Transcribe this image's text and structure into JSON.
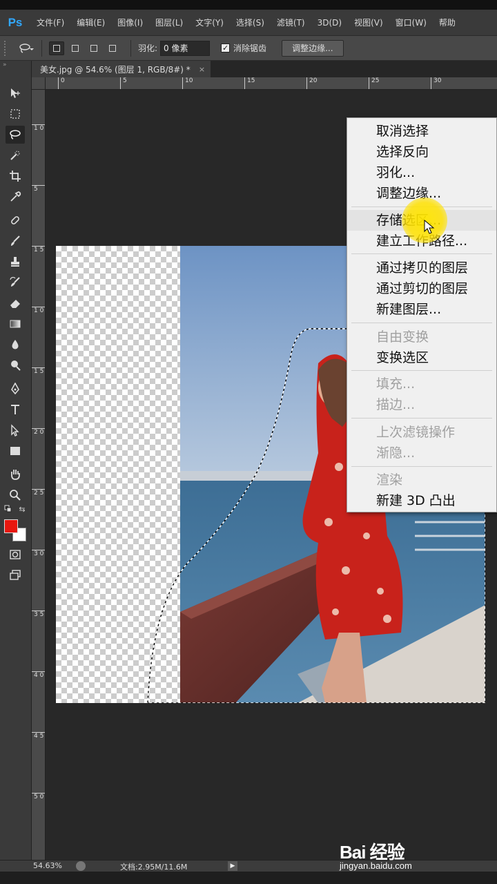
{
  "app": {
    "logo": "Ps"
  },
  "menubar": {
    "items": [
      "文件(F)",
      "编辑(E)",
      "图像(I)",
      "图层(L)",
      "文字(Y)",
      "选择(S)",
      "滤镜(T)",
      "3D(D)",
      "视图(V)",
      "窗口(W)",
      "帮助"
    ]
  },
  "options": {
    "feather_label": "羽化:",
    "feather_value": "0 像素",
    "antialias_label": "消除锯齿",
    "antialias_checked": "✓",
    "refine_edge_label": "调整边缘..."
  },
  "document": {
    "tab_title": "美女.jpg @ 54.6% (图层 1, RGB/8#) *",
    "close": "×"
  },
  "ruler": {
    "h_labels": [
      "0",
      "5",
      "10",
      "15",
      "20",
      "25",
      "30"
    ],
    "v_labels": [
      "1 0",
      "5",
      "1 5",
      "1 0",
      "1 5",
      "2 0",
      "2 5",
      "3 0",
      "3 5",
      "4 0",
      "4 5",
      "5 0"
    ]
  },
  "context_menu": {
    "items": [
      {
        "label": "取消选择",
        "enabled": true
      },
      {
        "label": "选择反向",
        "enabled": true
      },
      {
        "label": "羽化...",
        "enabled": true
      },
      {
        "label": "调整边缘...",
        "enabled": true
      },
      {
        "label": "存储选区...",
        "enabled": true
      },
      {
        "label": "建立工作路径...",
        "enabled": true
      },
      {
        "label": "通过拷贝的图层",
        "enabled": true
      },
      {
        "label": "通过剪切的图层",
        "enabled": true
      },
      {
        "label": "新建图层...",
        "enabled": true
      },
      {
        "label": "自由变换",
        "enabled": false
      },
      {
        "label": "变换选区",
        "enabled": true
      },
      {
        "label": "填充...",
        "enabled": false
      },
      {
        "label": "描边...",
        "enabled": false
      },
      {
        "label": "上次滤镜操作",
        "enabled": false
      },
      {
        "label": "渐隐...",
        "enabled": false
      },
      {
        "label": "渲染",
        "enabled": false
      },
      {
        "label": "新建 3D 凸出",
        "enabled": true
      }
    ]
  },
  "status": {
    "zoom": "54.63%",
    "doc_info": "文档:2.95M/11.6M"
  },
  "colors": {
    "foreground": "#e8170f",
    "background": "#ffffff"
  },
  "watermark": {
    "logo": "Bai 经验",
    "url": "jingyan.baidu.com"
  }
}
